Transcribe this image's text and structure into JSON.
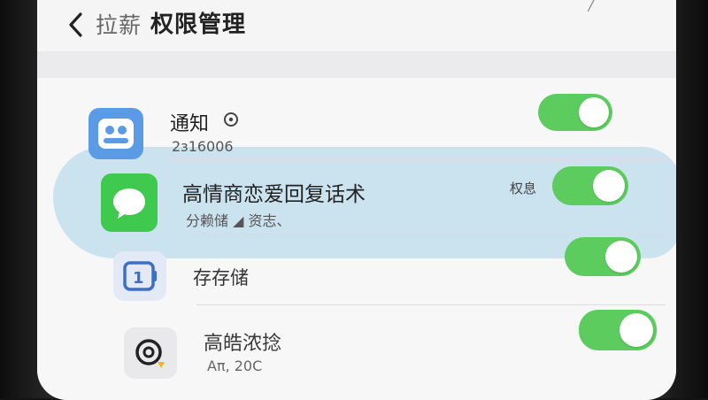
{
  "header": {
    "app_name": "拉薪",
    "title": "权限管理"
  },
  "rows": [
    {
      "title": "通知",
      "subtitle": "2з16006",
      "icon": "chat-bubble-icon",
      "toggle_on": true
    },
    {
      "title": "高情商恋爱回复话术",
      "subtitle": "分赖储 ◢ 资志、",
      "badge": "权息",
      "icon": "message-icon",
      "toggle_on": true
    },
    {
      "title": "存存储",
      "icon": "storage-icon",
      "toggle_on": true
    },
    {
      "title": "高皓浓捻",
      "subtitle": "Aπ, 20C",
      "icon": "camera-icon",
      "toggle_on": true
    }
  ],
  "colors": {
    "toggle_on": "#5ccc5e",
    "highlight": "#a8d2e8",
    "icon_blue": "#5b9be6",
    "icon_green": "#3fc94e"
  }
}
